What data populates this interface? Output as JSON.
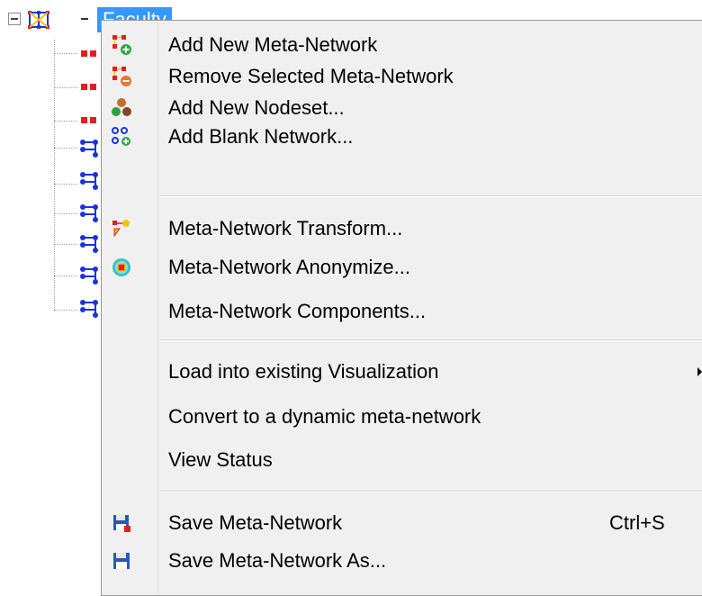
{
  "tree": {
    "root_label": "Faculty"
  },
  "menu": {
    "items": [
      {
        "label": "Add New Meta-Network",
        "icon": "add-meta-network-icon"
      },
      {
        "label": "Remove Selected Meta-Network",
        "icon": "remove-meta-network-icon"
      },
      {
        "label": "Add New Nodeset...",
        "icon": "add-nodeset-icon"
      },
      {
        "label": "Add Blank Network...",
        "icon": "add-blank-network-icon"
      },
      {
        "label": "Meta-Network Transform...",
        "icon": "transform-icon"
      },
      {
        "label": "Meta-Network Anonymize...",
        "icon": "anonymize-icon"
      },
      {
        "label": "Meta-Network Components..."
      },
      {
        "label": "Load into existing Visualization"
      },
      {
        "label": "Convert to a dynamic meta-network"
      },
      {
        "label": "View Status"
      },
      {
        "label": "Save Meta-Network",
        "icon": "save-icon",
        "shortcut": "Ctrl+S"
      },
      {
        "label": "Save Meta-Network As...",
        "icon": "save-as-icon"
      }
    ]
  },
  "colors": {
    "selection": "#3399ff",
    "menu_bg": "#f0f0f0",
    "node_red": "#e02020",
    "node_yellow": "#f5c400",
    "node_blue": "#1a35d6"
  }
}
